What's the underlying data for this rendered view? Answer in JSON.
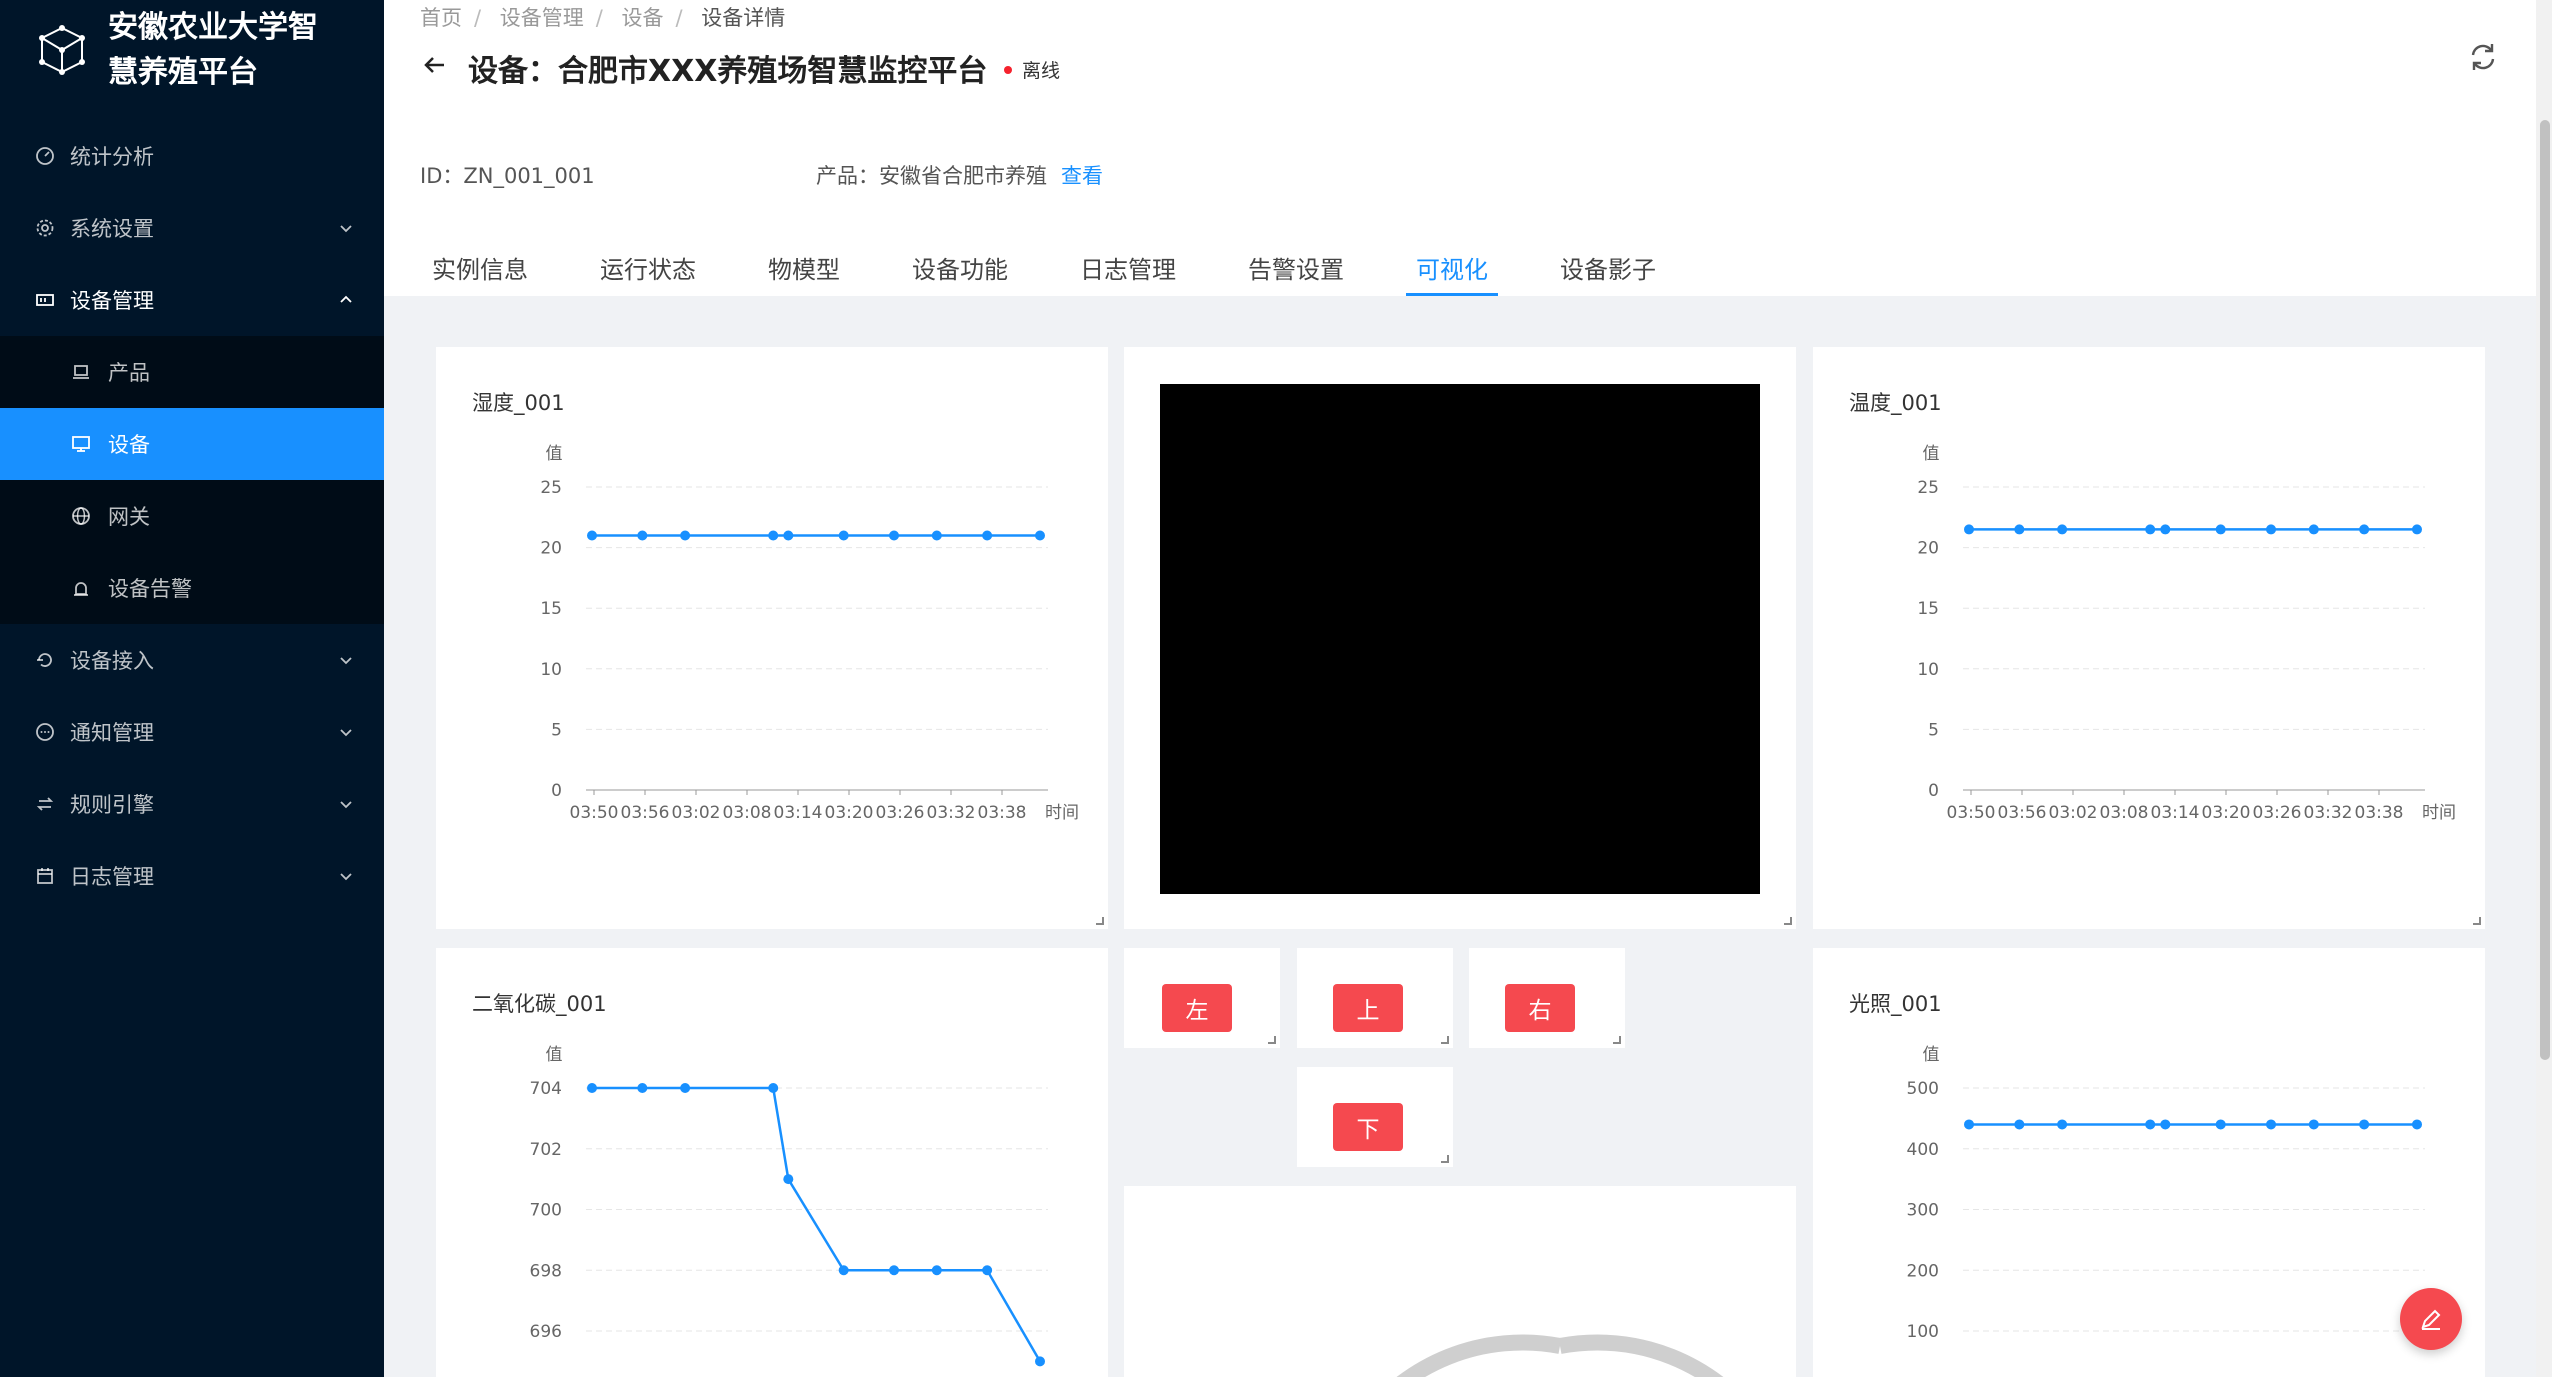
{
  "app": {
    "title": "安徽农业大学智慧养殖平台"
  },
  "sidebar": {
    "items": [
      {
        "label": "统计分析",
        "icon": "dashboard-icon"
      },
      {
        "label": "系统设置",
        "icon": "gear-icon"
      },
      {
        "label": "设备管理",
        "icon": "device-manage-icon"
      },
      {
        "label": "设备接入",
        "icon": "access-icon"
      },
      {
        "label": "通知管理",
        "icon": "message-icon"
      },
      {
        "label": "规则引擎",
        "icon": "rule-icon"
      },
      {
        "label": "日志管理",
        "icon": "calendar-icon"
      }
    ],
    "sub_items": [
      {
        "label": "产品",
        "icon": "laptop-icon"
      },
      {
        "label": "设备",
        "icon": "desktop-icon"
      },
      {
        "label": "网关",
        "icon": "globe-icon"
      },
      {
        "label": "设备告警",
        "icon": "alarm-icon"
      }
    ]
  },
  "breadcrumb": [
    "首页",
    "设备管理",
    "设备",
    "设备详情"
  ],
  "header": {
    "title": "设备：合肥市XXX养殖场智慧监控平台",
    "status": "离线",
    "id_label": "ID：ZN_001_001",
    "product_label": "产品：安徽省合肥市养殖",
    "view_link": "查看"
  },
  "tabs": [
    "实例信息",
    "运行状态",
    "物模型",
    "设备功能",
    "日志管理",
    "告警设置",
    "可视化",
    "设备影子"
  ],
  "active_tab": "可视化",
  "controls": {
    "left": "左",
    "up": "上",
    "right": "右",
    "down": "下"
  },
  "colors": {
    "accent": "#1890ff",
    "sidebar": "#001529",
    "danger": "#f5494f"
  },
  "chart_data": [
    {
      "type": "line",
      "title": "湿度_001",
      "ylabel": "值",
      "xlabel": "时间",
      "x": [
        "03:50",
        "03:56",
        "03:02",
        "03:08",
        "03:14",
        "03:20",
        "03:26",
        "03:32",
        "03:38"
      ],
      "points_x": [
        0,
        1,
        1.85,
        3.6,
        3.9,
        5,
        6,
        6.85,
        7.85,
        8.9
      ],
      "values": [
        21,
        21,
        21,
        21,
        21,
        21,
        21,
        21,
        21,
        21
      ],
      "yticks": [
        0,
        5,
        10,
        15,
        20,
        25
      ],
      "ylim": [
        0,
        25
      ]
    },
    {
      "type": "line",
      "title": "温度_001",
      "ylabel": "值",
      "xlabel": "时间",
      "x": [
        "03:50",
        "03:56",
        "03:02",
        "03:08",
        "03:14",
        "03:20",
        "03:26",
        "03:32",
        "03:38"
      ],
      "points_x": [
        0,
        1,
        1.85,
        3.6,
        3.9,
        5,
        6,
        6.85,
        7.85,
        8.9
      ],
      "values": [
        21.5,
        21.5,
        21.5,
        21.5,
        21.5,
        21.5,
        21.5,
        21.5,
        21.5,
        21.5
      ],
      "yticks": [
        0,
        5,
        10,
        15,
        20,
        25
      ],
      "ylim": [
        0,
        25
      ]
    },
    {
      "type": "line",
      "title": "二氧化碳_001",
      "ylabel": "值",
      "points_x": [
        0,
        1,
        1.85,
        3.6,
        3.9,
        5,
        6,
        6.85,
        7.85,
        8.9
      ],
      "values": [
        704,
        704,
        704,
        704,
        701,
        698,
        698,
        698,
        698,
        695
      ],
      "yticks": [
        696,
        698,
        700,
        702,
        704
      ],
      "ylim": [
        694,
        705.1
      ]
    },
    {
      "type": "line",
      "title": "光照_001",
      "ylabel": "值",
      "points_x": [
        0,
        1,
        1.85,
        3.6,
        3.9,
        5,
        6,
        6.85,
        7.85,
        8.9
      ],
      "values": [
        440,
        440,
        440,
        440,
        440,
        440,
        440,
        440,
        440,
        440
      ],
      "yticks": [
        100,
        200,
        300,
        400,
        500
      ],
      "ylim": [
        -50,
        560
      ]
    }
  ]
}
